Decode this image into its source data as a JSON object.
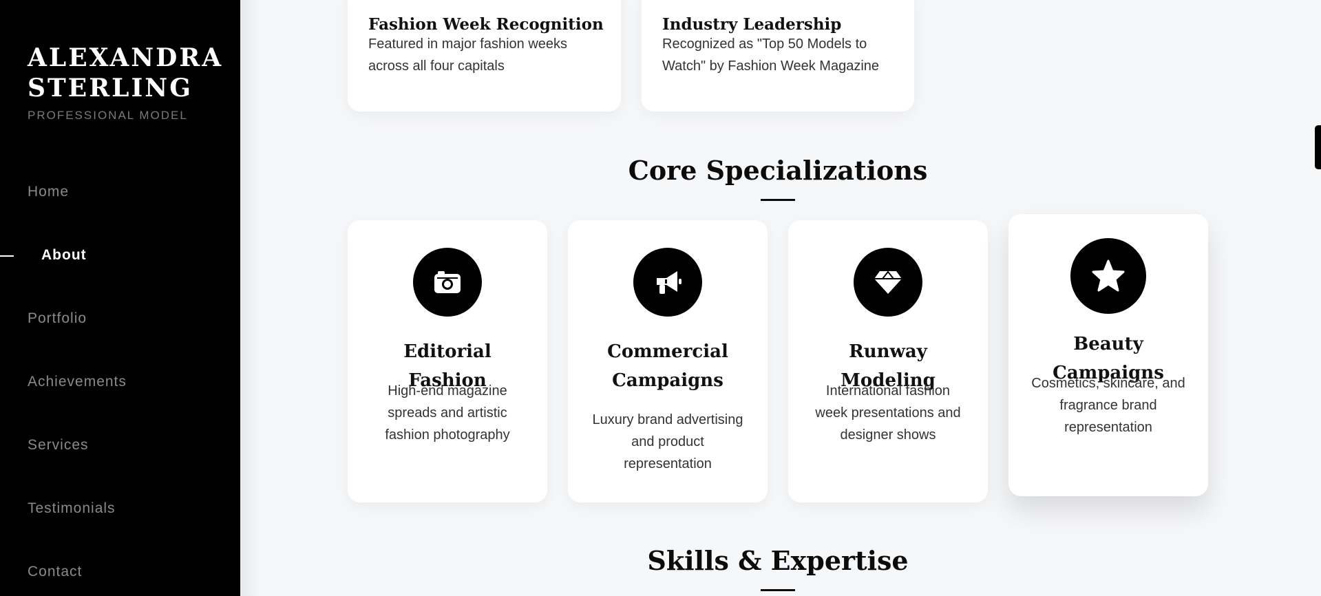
{
  "sidebar": {
    "name_line1": "ALEXANDRA",
    "name_line2": "STERLING",
    "subtitle": "PROFESSIONAL MODEL",
    "nav": [
      {
        "label": "Home"
      },
      {
        "label": "About",
        "active": true
      },
      {
        "label": "Portfolio"
      },
      {
        "label": "Achievements"
      },
      {
        "label": "Services"
      },
      {
        "label": "Testimonials"
      },
      {
        "label": "Contact"
      }
    ]
  },
  "achievements": [
    {
      "title": "Fashion Week Recognition",
      "desc": "Featured in major fashion weeks across all four capitals"
    },
    {
      "title": "Industry Leadership",
      "desc": "Recognized as \"Top 50 Models to Watch\" by Fashion Week Magazine"
    }
  ],
  "specializations": {
    "heading": "Core Specializations",
    "items": [
      {
        "icon": "camera-icon",
        "title": "Editorial Fashion",
        "desc": "High-end magazine spreads and artistic fashion photography"
      },
      {
        "icon": "megaphone-icon",
        "title": "Commercial Campaigns",
        "desc": "Luxury brand advertising and product representation"
      },
      {
        "icon": "gem-icon",
        "title": "Runway Modeling",
        "desc": "International fashion week presentations and designer shows"
      },
      {
        "icon": "star-icon",
        "title": "Beauty Campaigns",
        "desc": "Cosmetics, skincare, and fragrance brand representation"
      }
    ]
  },
  "skills": {
    "heading": "Skills & Expertise"
  },
  "colors": {
    "sidebar_bg": "#000000",
    "page_bg": "#f6f7f9",
    "accent": "#000000",
    "nav_inactive": "#8a8a8a"
  }
}
